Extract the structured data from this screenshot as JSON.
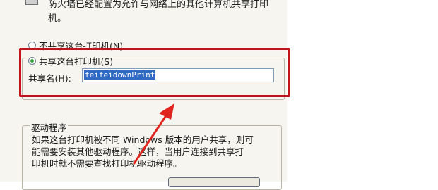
{
  "dialog": {
    "description_text": "防火墙已经配置为允许与网络上的其他计算机共享打印机。",
    "radio_no_share_label": "不共享这台打印机(N)",
    "radio_share_label": "共享这台打印机(S)",
    "share_name_label": "共享名(H):",
    "share_name_value": "feifeidownPrint",
    "drivers_title": "驱动程序",
    "drivers_text": "如果这台打印机被不同 Windows 版本的用户共享，则可\n能需要安装其他驱动程序。这样，当用户连接到共享打\n印机时就不需要查找打印机驱动程序。"
  },
  "colors": {
    "highlight_box": "#c0131c",
    "arrow": "#e0241e",
    "selected_radio": "#2fa03a",
    "selection": "#316ac5"
  }
}
